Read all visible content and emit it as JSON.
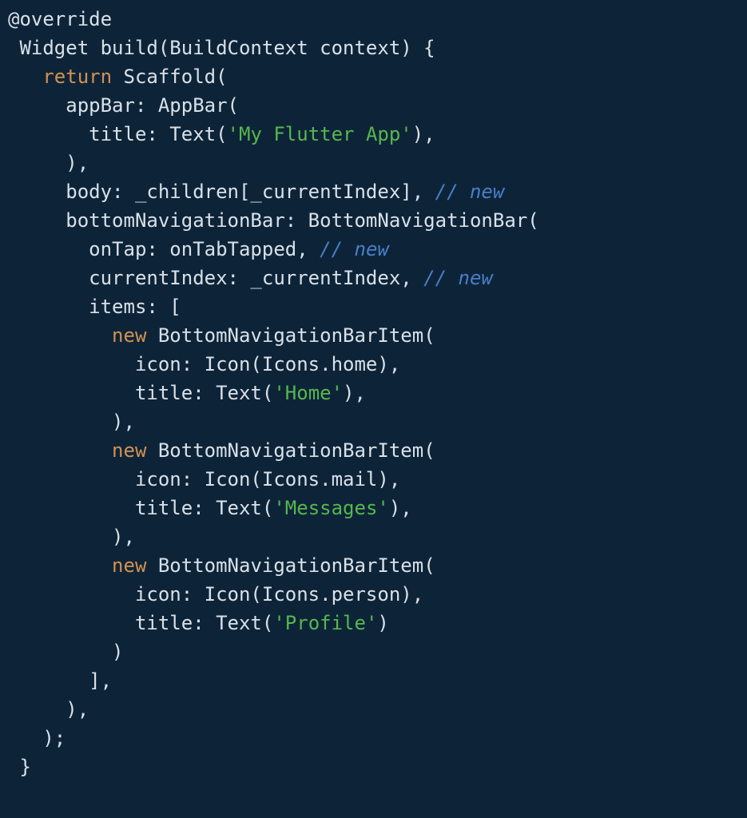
{
  "colors": {
    "background": "#0d2438",
    "default": "#d9e0e8",
    "keyword": "#d39152",
    "string": "#56b74e",
    "comment": "#4a7ec9",
    "indent_guide": "#20394f"
  },
  "code": {
    "lines": [
      [
        {
          "cls": "c-annot",
          "text": "@override"
        }
      ],
      [
        {
          "cls": "c-default",
          "text": " Widget build(BuildContext context) {"
        }
      ],
      [
        {
          "cls": "c-default",
          "text": "   "
        },
        {
          "cls": "c-keyword",
          "text": "return"
        },
        {
          "cls": "c-default",
          "text": " Scaffold("
        }
      ],
      [
        {
          "cls": "c-default",
          "text": "     appBar: AppBar("
        }
      ],
      [
        {
          "cls": "c-default",
          "text": "       title: Text("
        },
        {
          "cls": "c-string",
          "text": "'My Flutter App'"
        },
        {
          "cls": "c-default",
          "text": "),"
        }
      ],
      [
        {
          "cls": "c-default",
          "text": "     ),"
        }
      ],
      [
        {
          "cls": "c-default",
          "text": "     body: _children[_currentIndex], "
        },
        {
          "cls": "c-comment",
          "text": "// new"
        }
      ],
      [
        {
          "cls": "c-default",
          "text": "     bottomNavigationBar: BottomNavigationBar("
        }
      ],
      [
        {
          "cls": "c-default",
          "text": "       onTap: onTabTapped, "
        },
        {
          "cls": "c-comment",
          "text": "// new"
        }
      ],
      [
        {
          "cls": "c-default",
          "text": "       currentIndex: _currentIndex, "
        },
        {
          "cls": "c-comment",
          "text": "// new"
        }
      ],
      [
        {
          "cls": "c-default",
          "text": "       items: ["
        }
      ],
      [
        {
          "cls": "c-default",
          "text": "         "
        },
        {
          "cls": "c-keyword",
          "text": "new"
        },
        {
          "cls": "c-default",
          "text": " BottomNavigationBarItem("
        }
      ],
      [
        {
          "cls": "c-default",
          "text": "           icon: Icon(Icons.home),"
        }
      ],
      [
        {
          "cls": "c-default",
          "text": "           title: Text("
        },
        {
          "cls": "c-string",
          "text": "'Home'"
        },
        {
          "cls": "c-default",
          "text": "),"
        }
      ],
      [
        {
          "cls": "c-default",
          "text": "         ),"
        }
      ],
      [
        {
          "cls": "c-default",
          "text": "         "
        },
        {
          "cls": "c-keyword",
          "text": "new"
        },
        {
          "cls": "c-default",
          "text": " BottomNavigationBarItem("
        }
      ],
      [
        {
          "cls": "c-default",
          "text": "           icon: Icon(Icons.mail),"
        }
      ],
      [
        {
          "cls": "c-default",
          "text": "           title: Text("
        },
        {
          "cls": "c-string",
          "text": "'Messages'"
        },
        {
          "cls": "c-default",
          "text": "),"
        }
      ],
      [
        {
          "cls": "c-default",
          "text": "         ),"
        }
      ],
      [
        {
          "cls": "c-default",
          "text": "         "
        },
        {
          "cls": "c-keyword",
          "text": "new"
        },
        {
          "cls": "c-default",
          "text": " BottomNavigationBarItem("
        }
      ],
      [
        {
          "cls": "c-default",
          "text": "           icon: Icon(Icons.person),"
        }
      ],
      [
        {
          "cls": "c-default",
          "text": "           title: Text("
        },
        {
          "cls": "c-string",
          "text": "'Profile'"
        },
        {
          "cls": "c-default",
          "text": ")"
        }
      ],
      [
        {
          "cls": "c-default",
          "text": "         )"
        }
      ],
      [
        {
          "cls": "c-default",
          "text": "       ],"
        }
      ],
      [
        {
          "cls": "c-default",
          "text": "     ),"
        }
      ],
      [
        {
          "cls": "c-default",
          "text": "   );"
        }
      ],
      [
        {
          "cls": "c-default",
          "text": " }"
        }
      ]
    ]
  }
}
